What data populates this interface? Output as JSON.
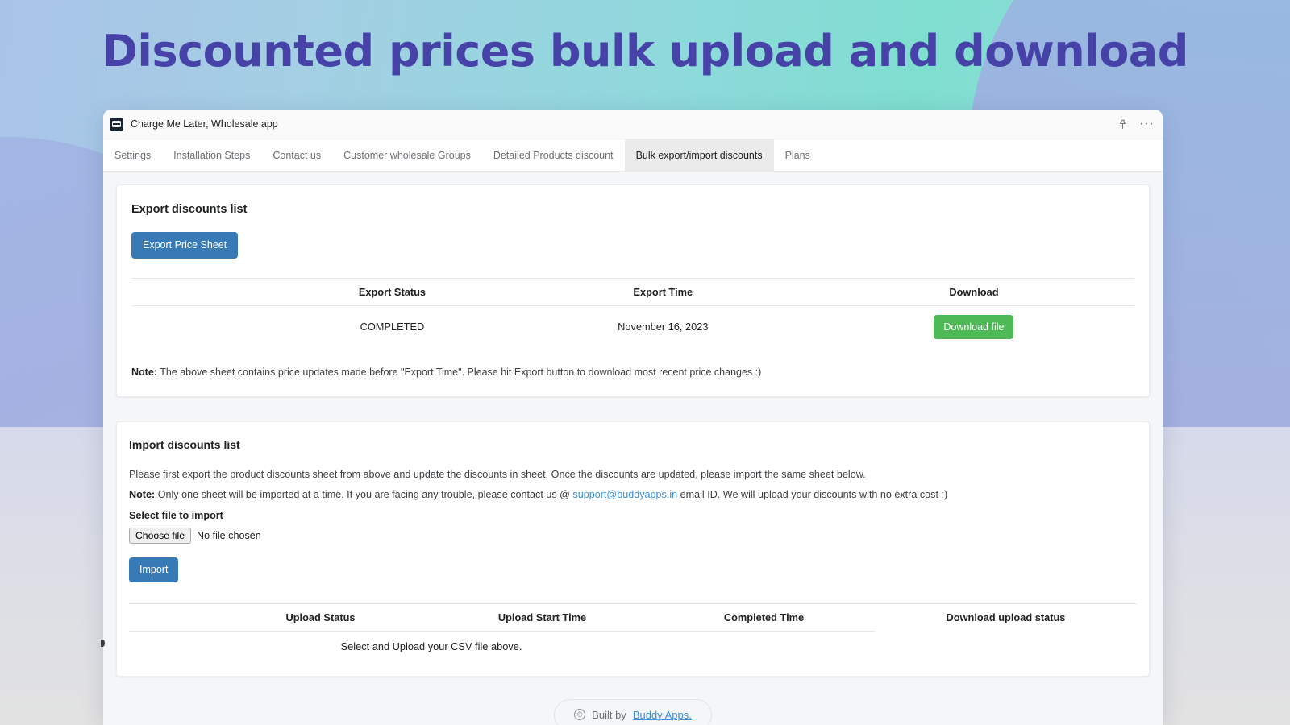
{
  "page": {
    "title": "Discounted prices bulk upload and download",
    "title_color": "#4642a8"
  },
  "window": {
    "app_title": "Charge Me Later, Wholesale app",
    "app_icon": "credit-card-icon",
    "pin_icon": "pin-icon",
    "more_icon": "ellipsis-icon",
    "more_label": "···"
  },
  "tabs": [
    {
      "label": "Settings",
      "active": false
    },
    {
      "label": "Installation Steps",
      "active": false
    },
    {
      "label": "Contact us",
      "active": false
    },
    {
      "label": "Customer wholesale Groups",
      "active": false
    },
    {
      "label": "Detailed Products discount",
      "active": false
    },
    {
      "label": "Bulk export/import discounts",
      "active": true
    },
    {
      "label": "Plans",
      "active": false
    }
  ],
  "export_card": {
    "title": "Export discounts list",
    "export_button": "Export Price Sheet",
    "columns": [
      "Export Status",
      "Export Time",
      "Download"
    ],
    "rows": [
      {
        "status": "COMPLETED",
        "status_color": "#2aa12f",
        "time": "November 16, 2023",
        "download_button": "Download file",
        "download_button_color": "#4fb958"
      }
    ],
    "note_label": "Note:",
    "note_text": "The above sheet contains price updates made before \"Export Time\". Please hit Export button to download most recent price changes :)"
  },
  "import_card": {
    "title": "Import discounts list",
    "intro": "Please first export the product discounts sheet from above and update the discounts in sheet. Once the discounts are updated, please import the same sheet below.",
    "note_label": "Note:",
    "note_before_link": "Only one sheet will be imported at a time. If you are facing any trouble, please contact us @ ",
    "note_link": "support@buddyapps.in",
    "note_after_link": " email ID. We will upload your discounts with no extra cost :)",
    "file_label": "Select file to import",
    "choose_file_button": "Choose file",
    "file_status": "No file chosen",
    "import_button": "Import",
    "columns": [
      "Upload Status",
      "Upload Start Time",
      "Completed Time",
      "Download upload status"
    ],
    "empty_message": "Select and Upload your CSV file above."
  },
  "footer": {
    "copyright_mark": "©",
    "built_by": "Built by",
    "brand": "Buddy Apps."
  }
}
